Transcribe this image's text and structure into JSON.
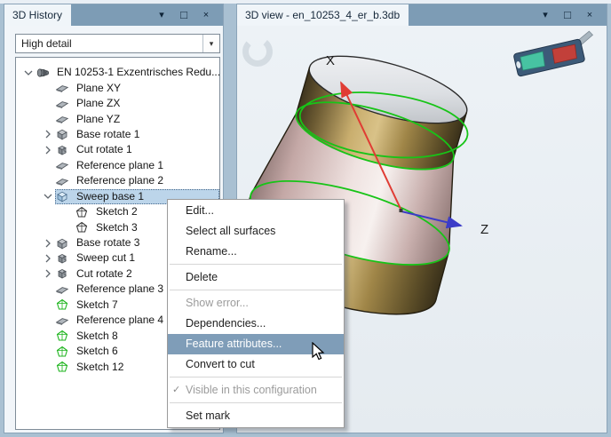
{
  "left_panel": {
    "title": "3D History",
    "detail_level": "High detail",
    "tree": [
      {
        "label": "EN 10253-1 Exzentrisches Redu...",
        "level": 0,
        "expand": "down",
        "icon": "part"
      },
      {
        "label": "Plane XY",
        "level": 1,
        "expand": null,
        "icon": "plane"
      },
      {
        "label": "Plane ZX",
        "level": 1,
        "expand": null,
        "icon": "plane"
      },
      {
        "label": "Plane YZ",
        "level": 1,
        "expand": null,
        "icon": "plane"
      },
      {
        "label": "Base rotate 1",
        "level": 1,
        "expand": "right",
        "icon": "box"
      },
      {
        "label": "Cut rotate 1",
        "level": 1,
        "expand": "right",
        "icon": "cut"
      },
      {
        "label": "Reference plane 1",
        "level": 1,
        "expand": null,
        "icon": "plane"
      },
      {
        "label": "Reference plane 2",
        "level": 1,
        "expand": null,
        "icon": "plane"
      },
      {
        "label": "Sweep base 1",
        "level": 1,
        "expand": "down",
        "icon": "sweep",
        "selected": true
      },
      {
        "label": "Sketch 2",
        "level": 2,
        "expand": null,
        "icon": "sketch",
        "icon_variant": "dark"
      },
      {
        "label": "Sketch 3",
        "level": 2,
        "expand": null,
        "icon": "sketch",
        "icon_variant": "dark"
      },
      {
        "label": "Base rotate 3",
        "level": 1,
        "expand": "right",
        "icon": "box"
      },
      {
        "label": "Sweep cut 1",
        "level": 1,
        "expand": "right",
        "icon": "cut"
      },
      {
        "label": "Cut rotate 2",
        "level": 1,
        "expand": "right",
        "icon": "cut"
      },
      {
        "label": "Reference plane 3",
        "level": 1,
        "expand": null,
        "icon": "plane"
      },
      {
        "label": "Sketch 7",
        "level": 1,
        "expand": null,
        "icon": "sketch",
        "icon_variant": "green"
      },
      {
        "label": "Reference plane 4",
        "level": 1,
        "expand": null,
        "icon": "plane"
      },
      {
        "label": "Sketch 8",
        "level": 1,
        "expand": null,
        "icon": "sketch",
        "icon_variant": "green"
      },
      {
        "label": "Sketch 6",
        "level": 1,
        "expand": null,
        "icon": "sketch",
        "icon_variant": "green"
      },
      {
        "label": "Sketch 12",
        "level": 1,
        "expand": null,
        "icon": "sketch",
        "icon_variant": "green"
      }
    ]
  },
  "context_menu": {
    "items": [
      {
        "label": "Edit..."
      },
      {
        "label": "Select all surfaces"
      },
      {
        "label": "Rename..."
      },
      {
        "separator": true
      },
      {
        "label": "Delete"
      },
      {
        "separator": true
      },
      {
        "label": "Show error...",
        "disabled": true
      },
      {
        "label": "Dependencies..."
      },
      {
        "label": "Feature attributes...",
        "highlighted": true
      },
      {
        "label": "Convert to cut"
      },
      {
        "separator": true
      },
      {
        "label": "Visible in this configuration",
        "disabled": true,
        "checked": true
      },
      {
        "separator": true
      },
      {
        "label": "Set mark"
      }
    ],
    "check_glyph": "✓"
  },
  "right_panel": {
    "title": "3D view - en_10253_4_er_b.3db",
    "axis_labels": {
      "x": "X",
      "z": "Z"
    }
  },
  "window_controls": {
    "menu_glyph": "▾",
    "maximize_glyph": "□",
    "close_glyph": "×"
  },
  "colors": {
    "titlebar": "#7d9cb5",
    "menu_highlight": "#7f9db8",
    "tree_selection": "#bcd5ea",
    "history_line": "#1a1acc",
    "axis_x": "#e03c34",
    "axis_z": "#3c3cc8",
    "edge_highlight": "#17c417"
  }
}
